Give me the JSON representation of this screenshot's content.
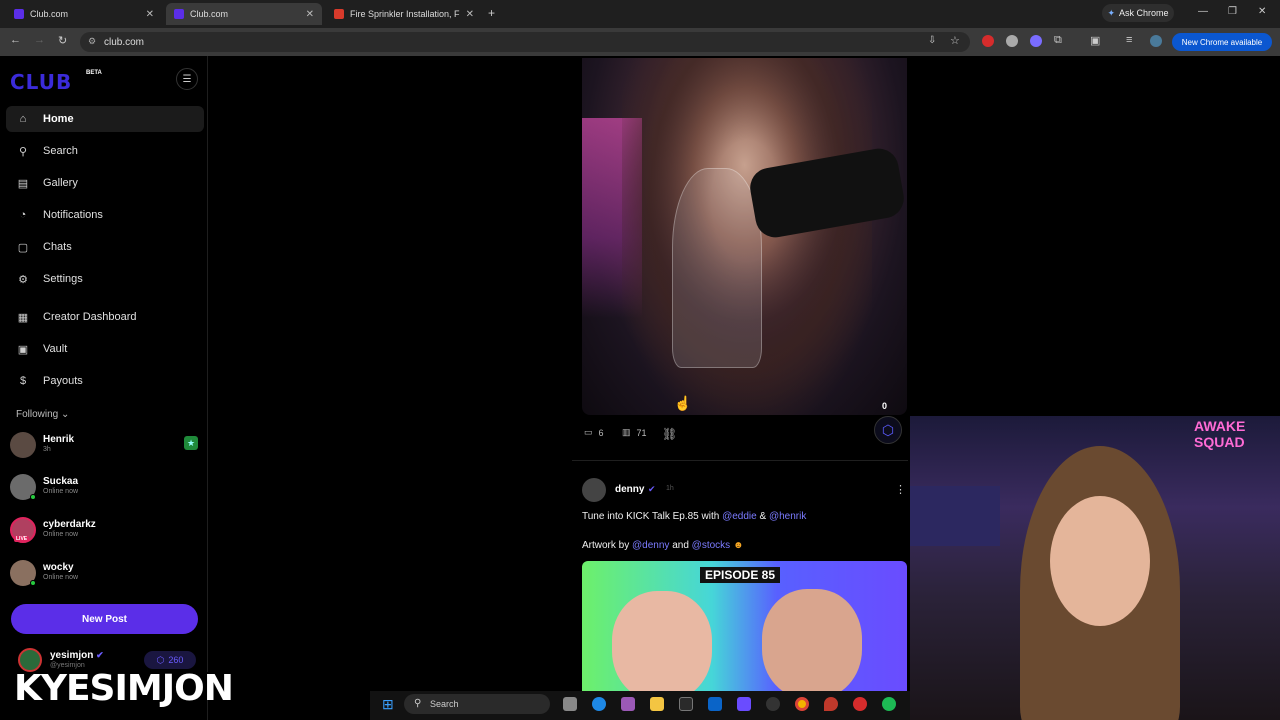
{
  "browser": {
    "tabs": [
      {
        "title": "Club.com",
        "active": false
      },
      {
        "title": "Club.com",
        "active": true
      },
      {
        "title": "Fire Sprinkler Installation, Fire A",
        "active": false
      }
    ],
    "new_tab": "+",
    "ask_chrome": "Ask Chrome",
    "url": "club.com",
    "new_chrome": "New Chrome available"
  },
  "sidebar": {
    "logo": "CLUB",
    "beta": "BETA",
    "nav": [
      {
        "label": "Home",
        "icon": "home-icon"
      },
      {
        "label": "Search",
        "icon": "search-icon"
      },
      {
        "label": "Gallery",
        "icon": "gallery-icon"
      },
      {
        "label": "Notifications",
        "icon": "bell-icon"
      },
      {
        "label": "Chats",
        "icon": "chat-icon"
      },
      {
        "label": "Settings",
        "icon": "gear-icon"
      },
      {
        "label": "Creator Dashboard",
        "icon": "dashboard-icon"
      },
      {
        "label": "Vault",
        "icon": "vault-icon"
      },
      {
        "label": "Payouts",
        "icon": "dollar-icon"
      }
    ],
    "following_label": "Following",
    "following": [
      {
        "name": "Henrik",
        "status": "3h"
      },
      {
        "name": "Suckaa",
        "status": "Online now"
      },
      {
        "name": "cyberdarkz",
        "status": "Online now",
        "live": "LIVE"
      },
      {
        "name": "wocky",
        "status": "Online now"
      }
    ],
    "new_post": "New Post",
    "me": {
      "name": "yesimjon",
      "handle": "@yesimjon",
      "points": "260"
    }
  },
  "feed": {
    "post1": {
      "comments": "6",
      "views": "71",
      "tip_count": "0"
    },
    "post2": {
      "author": "denny",
      "time": "1h",
      "line1_prefix": "Tune into KICK Talk Ep.85 with",
      "mention_a": "@eddie",
      "amp": "&",
      "mention_b": "@henrik",
      "line2_prefix": "Artwork by",
      "mention_c": "@denny",
      "and": "and",
      "mention_d": "@stocks",
      "episode_badge": "EPISODE 85"
    }
  },
  "overlay": {
    "watermark": "KYESIMJON",
    "sign": "AWAKE SQUAD"
  },
  "taskbar": {
    "search": "Search"
  }
}
